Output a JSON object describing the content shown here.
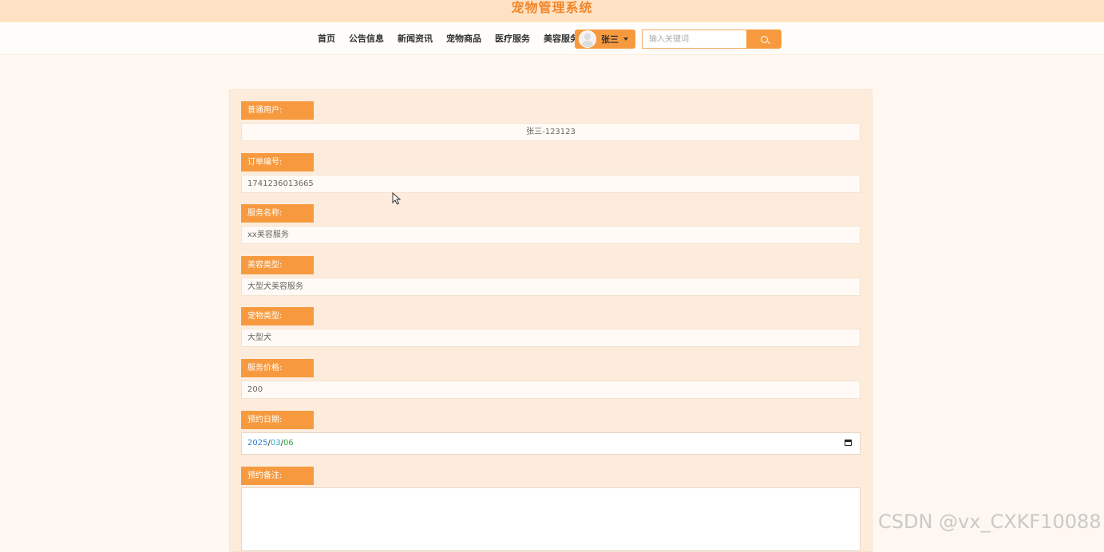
{
  "site": {
    "title": "宠物管理系统"
  },
  "nav": {
    "items": [
      {
        "label": "首页"
      },
      {
        "label": "公告信息"
      },
      {
        "label": "新闻资讯"
      },
      {
        "label": "宠物商品"
      },
      {
        "label": "医疗服务"
      },
      {
        "label": "美容服务"
      }
    ],
    "user_name": "张三",
    "search_placeholder": "输入关键词"
  },
  "form": {
    "user": {
      "label": "普通用户:",
      "value": "张三-123123"
    },
    "order_no": {
      "label": "订单编号:",
      "value": "1741236013665"
    },
    "service_name": {
      "label": "服务名称:",
      "value": "xx美容服务"
    },
    "beauty_type": {
      "label": "美容类型:",
      "value": "大型犬美容服务"
    },
    "pet_type": {
      "label": "宠物类型:",
      "value": "大型犬"
    },
    "price": {
      "label": "服务价格:",
      "value": "200"
    },
    "date": {
      "label": "预约日期:",
      "year": "2025",
      "month": "03",
      "day": "06",
      "sep": "/"
    },
    "notes": {
      "label": "预约备注:",
      "value": ""
    }
  },
  "watermark": "CSDN @vx_CXKF10088",
  "colors": {
    "accent": "#f79a3f",
    "title": "#f0862a",
    "panel": "#fdecdc",
    "page_bg": "#fff8f0"
  }
}
